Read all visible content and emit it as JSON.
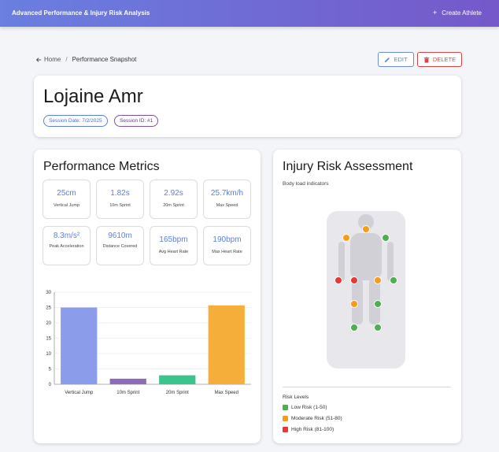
{
  "app": {
    "title": "Advanced Performance & Injury Risk Analysis",
    "create_label": "Create Athlete"
  },
  "breadcrumb": {
    "home": "Home",
    "current": "Performance Snapshot"
  },
  "actions": {
    "edit": "EDIT",
    "delete": "DELETE"
  },
  "athlete": {
    "name": "Lojaine Amr",
    "session_date": "Session Date: 7/2/2025",
    "session_id": "Session ID: #1"
  },
  "metrics": {
    "title": "Performance Metrics",
    "items": [
      {
        "value": "25cm",
        "label": "Vertical Jump"
      },
      {
        "value": "1.82s",
        "label": "10m Sprint"
      },
      {
        "value": "2.92s",
        "label": "20m Sprint"
      },
      {
        "value": "25.7km/h",
        "label": "Max Speed"
      },
      {
        "value": "8.3m/s²",
        "label": "Peak Acceleration"
      },
      {
        "value": "9610m",
        "label": "Distance Covered"
      },
      {
        "value": "165bpm",
        "label": "Avg Heart Rate"
      },
      {
        "value": "190bpm",
        "label": "Max Heart Rate"
      }
    ]
  },
  "chart_data": {
    "type": "bar",
    "categories": [
      "Vertical Jump",
      "10m Sprint",
      "20m Sprint",
      "Max Speed"
    ],
    "values": [
      25,
      1.82,
      2.92,
      25.7
    ],
    "colors": [
      "#8a9cea",
      "#8e6bb8",
      "#3cc48e",
      "#f5ae3a"
    ],
    "ylim": [
      0,
      30
    ],
    "yticks": [
      0,
      5,
      10,
      15,
      20,
      25,
      30
    ],
    "grid": true
  },
  "risk": {
    "title": "Injury Risk Assessment",
    "subtitle": "Body load indicators",
    "legend_title": "Risk Levels",
    "levels": [
      {
        "label": "Low Risk (1-50)",
        "color": "#4caf50"
      },
      {
        "label": "Moderate Risk (51-80)",
        "color": "#f59c1a"
      },
      {
        "label": "High Risk (81-100)",
        "color": "#e53935"
      }
    ],
    "indicators": [
      {
        "name": "neck",
        "level": "moderate"
      },
      {
        "name": "right-shoulder",
        "level": "moderate"
      },
      {
        "name": "left-shoulder",
        "level": "low"
      },
      {
        "name": "right-hand",
        "level": "high"
      },
      {
        "name": "right-hip",
        "level": "high"
      },
      {
        "name": "left-hip",
        "level": "moderate"
      },
      {
        "name": "left-hand",
        "level": "low"
      },
      {
        "name": "right-knee",
        "level": "moderate"
      },
      {
        "name": "left-knee",
        "level": "low"
      },
      {
        "name": "right-ankle",
        "level": "low"
      },
      {
        "name": "left-ankle",
        "level": "low"
      }
    ]
  }
}
